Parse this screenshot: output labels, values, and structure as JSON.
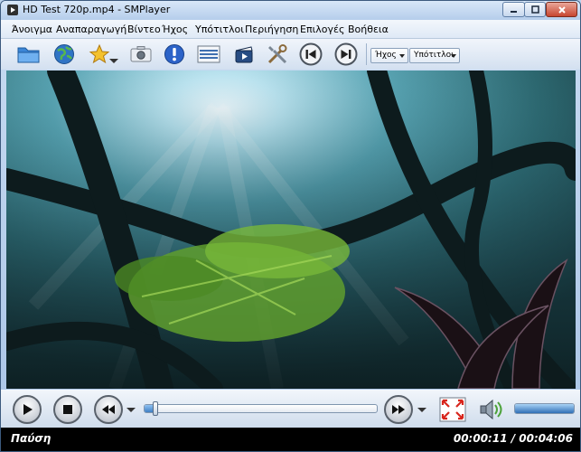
{
  "window": {
    "title": "HD Test 720p.mp4 - SMPlayer"
  },
  "menu": [
    "Άνοιγμα",
    "Αναπαραγωγή",
    "Βίντεο",
    "Ήχος",
    "Υπότιτλοι",
    "Περιήγηση",
    "Επιλογές",
    "Βοήθεια"
  ],
  "toolbar": {
    "icons": [
      "folder-icon",
      "globe-icon",
      "star-icon",
      "screenshot-camera-icon",
      "info-icon",
      "playlist-icon",
      "film-clapper-icon",
      "tools-icon",
      "previous-icon",
      "next-icon"
    ],
    "audio_combo": "Ήχος",
    "subtitles_combo": "Υπότιτλοι"
  },
  "controls": {
    "seek_fraction": 0.045,
    "volume_fraction": 1.0
  },
  "status": {
    "state": "Παύση",
    "time": "00:00:11 / 00:04:06"
  },
  "colors": {
    "accent": "#3f7fc4",
    "statusbar": "#000000"
  }
}
